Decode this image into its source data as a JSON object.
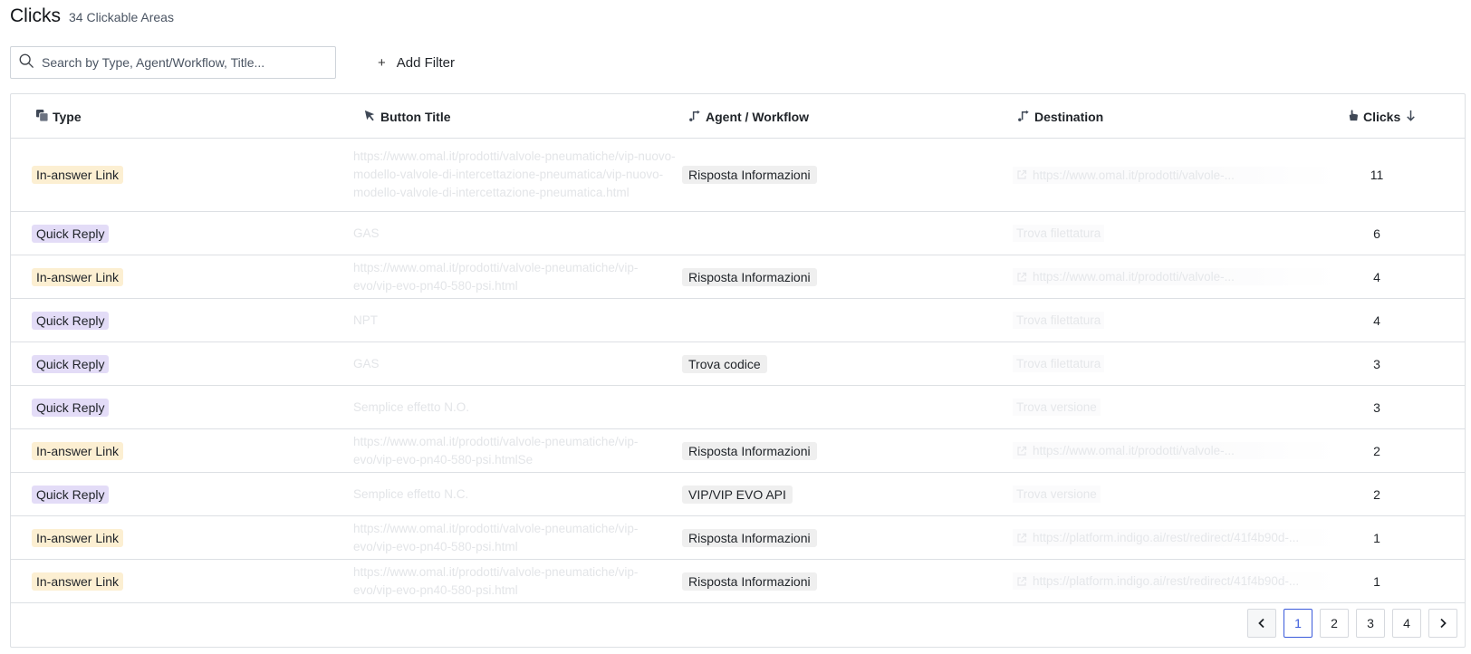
{
  "header": {
    "title": "Clicks",
    "subtitle": "34 Clickable Areas"
  },
  "search": {
    "placeholder": "Search by Type, Agent/Workflow, Title..."
  },
  "filter": {
    "add_label": "Add Filter"
  },
  "table": {
    "columns": {
      "type": "Type",
      "button_title": "Button Title",
      "agent": "Agent / Workflow",
      "destination": "Destination",
      "clicks": "Clicks"
    },
    "rows": [
      {
        "type": "In-answer Link",
        "title": "https://www.omal.it/prodotti/valvole-pneumatiche/vip-nuovo-modello-valvole-di-intercettazione-pneumatica/vip-nuovo-modello-valvole-di-intercettazione-pneumatica.html",
        "agent": "Risposta Informazioni",
        "destination": "https://www.omal.it/prodotti/valvole-...",
        "clicks": "11"
      },
      {
        "type": "Quick Reply",
        "title": "GAS",
        "agent": "",
        "destination": "Trova filettatura",
        "clicks": "6"
      },
      {
        "type": "In-answer Link",
        "title": "https://www.omal.it/prodotti/valvole-pneumatiche/vip-evo/vip-evo-pn40-580-psi.html",
        "agent": "Risposta Informazioni",
        "destination": "https://www.omal.it/prodotti/valvole-...",
        "clicks": "4"
      },
      {
        "type": "Quick Reply",
        "title": "NPT",
        "agent": "",
        "destination": "Trova filettatura",
        "clicks": "4"
      },
      {
        "type": "Quick Reply",
        "title": "GAS",
        "agent": "Trova codice",
        "destination": "Trova filettatura",
        "clicks": "3"
      },
      {
        "type": "Quick Reply",
        "title": "Semplice effetto N.O.",
        "agent": "",
        "destination": "Trova versione",
        "clicks": "3"
      },
      {
        "type": "In-answer Link",
        "title": "https://www.omal.it/prodotti/valvole-pneumatiche/vip-evo/vip-evo-pn40-580-psi.htmlSe",
        "agent": "Risposta Informazioni",
        "destination": "https://www.omal.it/prodotti/valvole-...",
        "clicks": "2"
      },
      {
        "type": "Quick Reply",
        "title": "Semplice effetto N.C.",
        "agent": "VIP/VIP EVO API",
        "destination": "Trova versione",
        "clicks": "2"
      },
      {
        "type": "In-answer Link",
        "title": "https://www.omal.it/prodotti/valvole-pneumatiche/vip-evo/vip-evo-pn40-580-psi.html",
        "agent": "Risposta Informazioni",
        "destination": "https://platform.indigo.ai/rest/redirect/41f4b90d-...",
        "clicks": "1"
      },
      {
        "type": "In-answer Link",
        "title": "https://www.omal.it/prodotti/valvole-pneumatiche/vip-evo/vip-evo-pn40-580-psi.html",
        "agent": "Risposta Informazioni",
        "destination": "https://platform.indigo.ai/rest/redirect/41f4b90d-...",
        "clicks": "1"
      }
    ]
  },
  "pagination": {
    "pages": [
      "1",
      "2",
      "3",
      "4"
    ],
    "current": "1"
  },
  "colors": {
    "in_answer_link_badge": "#fcefd2",
    "quick_reply_badge": "#e3dcf7",
    "agent_chip": "#efefef",
    "active_page": "#3b5bdb"
  },
  "icons": {
    "search": "search-icon",
    "add": "plus-icon",
    "type": "type-icon",
    "button_title": "cursor-icon",
    "agent": "workflow-icon",
    "destination": "workflow-icon",
    "clicks": "pointer-hand-icon",
    "sort": "arrow-down-icon",
    "external": "external-link-icon",
    "prev": "chevron-left-icon",
    "next": "chevron-right-icon"
  }
}
